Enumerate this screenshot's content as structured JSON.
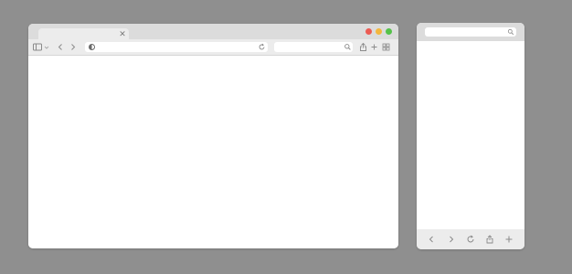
{
  "desktop_browser": {
    "tab": {
      "close_icon": "close-icon"
    },
    "window_controls": {
      "close_color": "#ec5b53",
      "minimize_color": "#f3b73e",
      "zoom_color": "#55c24a"
    },
    "toolbar": {
      "sidebar_icon": "sidebar-icon",
      "back_icon": "chevron-left-icon",
      "forward_icon": "chevron-right-icon",
      "privacy_icon": "half-circle-icon",
      "reload_icon": "reload-icon",
      "search_icon": "search-icon",
      "share_icon": "share-icon",
      "new_tab_icon": "plus-icon",
      "tab_overview_icon": "grid-icon"
    }
  },
  "mobile_browser": {
    "address_bar": {
      "search_icon": "search-icon"
    },
    "bottom_bar": {
      "back_icon": "chevron-left-icon",
      "forward_icon": "chevron-right-icon",
      "reload_icon": "reload-icon",
      "share_icon": "share-icon",
      "new_tab_icon": "plus-icon"
    }
  },
  "colors": {
    "background": "#8f8f8f",
    "chrome_dark": "#dcdcdc",
    "chrome_light": "#ececec",
    "icon": "#8a8a8a"
  }
}
